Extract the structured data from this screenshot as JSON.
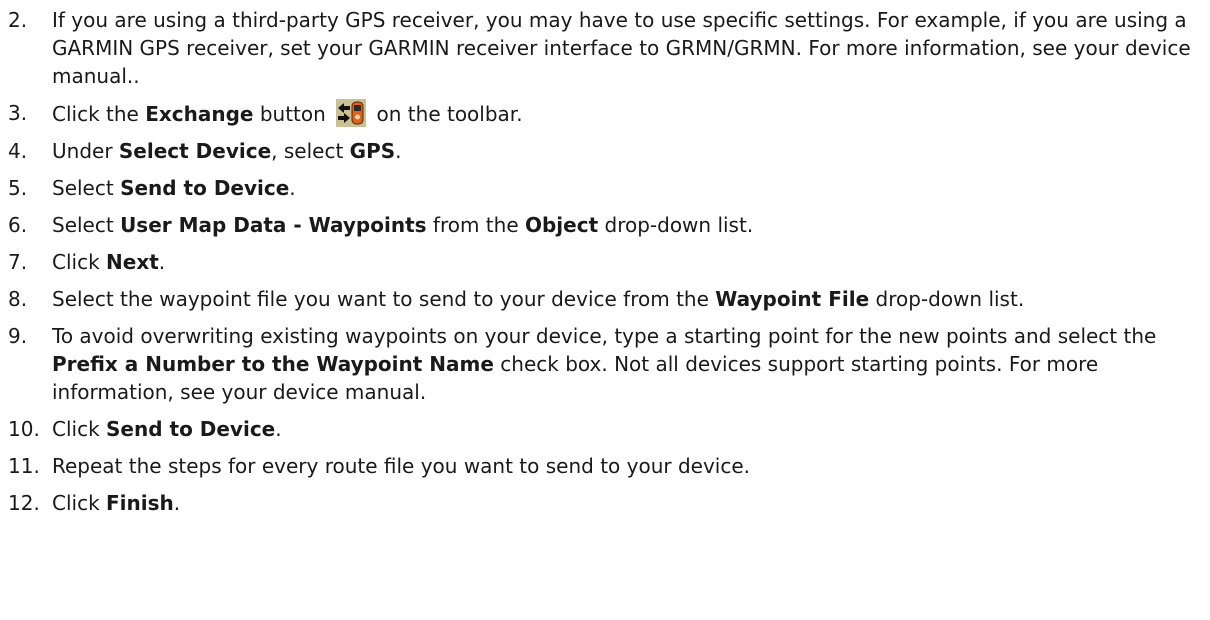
{
  "steps": [
    {
      "num": "2.",
      "parts": [
        {
          "t": "If you are using a third-party GPS receiver, you may have to use specific settings. For example, if you are using a GARMIN GPS receiver, set your GARMIN receiver interface to GRMN/GRMN. For more information, see your device manual.."
        }
      ]
    },
    {
      "num": "3.",
      "parts": [
        {
          "t": "Click the "
        },
        {
          "t": "Exchange",
          "b": true
        },
        {
          "t": " button "
        },
        {
          "icon": "exchange-icon"
        },
        {
          "t": " on the toolbar."
        }
      ]
    },
    {
      "num": "4.",
      "parts": [
        {
          "t": "Under "
        },
        {
          "t": "Select Device",
          "b": true
        },
        {
          "t": ", select "
        },
        {
          "t": "GPS",
          "b": true
        },
        {
          "t": "."
        }
      ]
    },
    {
      "num": "5.",
      "parts": [
        {
          "t": "Select "
        },
        {
          "t": "Send to Device",
          "b": true
        },
        {
          "t": "."
        }
      ]
    },
    {
      "num": "6.",
      "parts": [
        {
          "t": "Select "
        },
        {
          "t": "User Map Data - Waypoints",
          "b": true
        },
        {
          "t": " from the "
        },
        {
          "t": "Object",
          "b": true
        },
        {
          "t": " drop-down list."
        }
      ]
    },
    {
      "num": "7.",
      "parts": [
        {
          "t": "Click "
        },
        {
          "t": "Next",
          "b": true
        },
        {
          "t": "."
        }
      ]
    },
    {
      "num": "8.",
      "parts": [
        {
          "t": "Select the waypoint file you want to send to your device from the "
        },
        {
          "t": "Waypoint File",
          "b": true
        },
        {
          "t": " drop-down list."
        }
      ]
    },
    {
      "num": "9.",
      "parts": [
        {
          "t": "To avoid overwriting existing waypoints on your device, type a starting point for the new points and select the "
        },
        {
          "t": "Prefix a Number to the Waypoint Name",
          "b": true
        },
        {
          "t": " check box. Not all devices support starting points. For more information, see your device manual."
        }
      ]
    },
    {
      "num": "10.",
      "parts": [
        {
          "t": "Click "
        },
        {
          "t": "Send to Device",
          "b": true
        },
        {
          "t": "."
        }
      ]
    },
    {
      "num": "11.",
      "parts": [
        {
          "t": "Repeat the steps for every route file you want to send to your device."
        }
      ]
    },
    {
      "num": "12.",
      "parts": [
        {
          "t": "Click "
        },
        {
          "t": "Finish",
          "b": true
        },
        {
          "t": "."
        }
      ]
    }
  ],
  "colors": {
    "text": "#1a1a1a",
    "icon_bg": "#c9c194",
    "icon_accent": "#e0601c"
  }
}
